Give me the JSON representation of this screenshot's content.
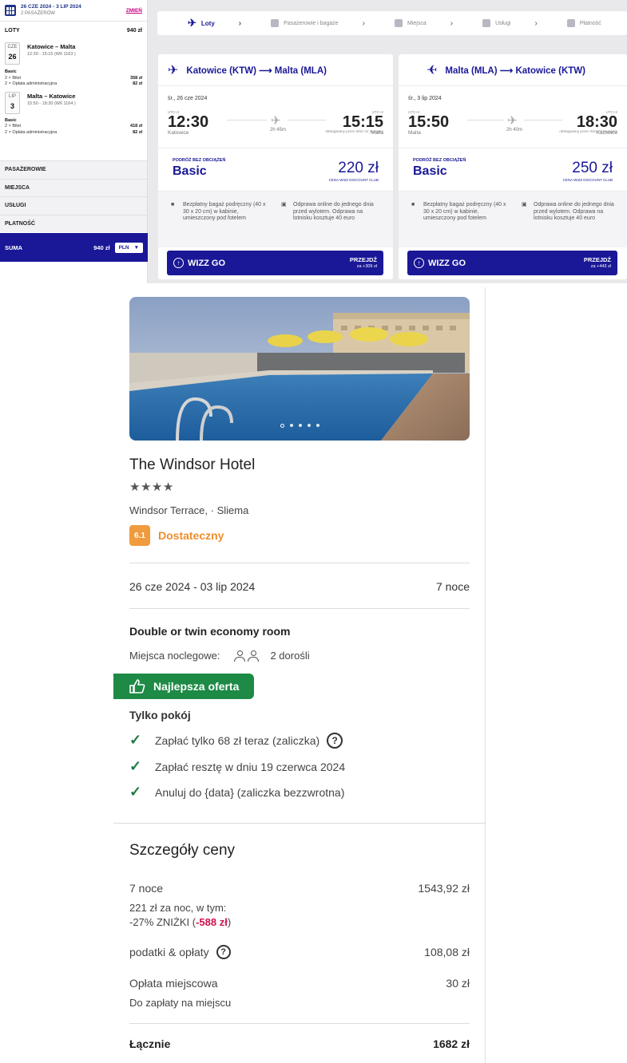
{
  "summary": {
    "dates": "26 CZE 2024 - 3 LIP 2024",
    "passengers": "2 PASAŻERÓW",
    "change": "ZMIEŃ",
    "flights_label": "LOTY",
    "flights_total": "940 zł",
    "legs": [
      {
        "month": "CZE",
        "day": "26",
        "route": "Katowice – Malta",
        "times": "12:30 - 15:15 (W6 1163 )",
        "fare": "Basic",
        "ticket_label": "2 × Bilet",
        "ticket_price": "358 zł",
        "fee_label": "2 × Opłata administracyjna",
        "fee_price": "82 zł"
      },
      {
        "month": "LIP",
        "day": "3",
        "route": "Malta – Katowice",
        "times": "15:50 - 18:30 (W6 1164 )",
        "fare": "Basic",
        "ticket_label": "2 × Bilet",
        "ticket_price": "418 zł",
        "fee_label": "2 × Opłata administracyjna",
        "fee_price": "82 zł"
      }
    ],
    "categories": [
      "PASAŻEROWIE",
      "MIEJSCA",
      "USŁUGI",
      "PŁATNOŚĆ"
    ],
    "total_label": "SUMA",
    "total_value": "940 zł",
    "currency": "PLN"
  },
  "steps": [
    "Loty",
    "Pasażerowie i bagaże",
    "Miejsca",
    "Usługi",
    "Płatność"
  ],
  "cards": [
    {
      "route": "Katowice (KTW) ⟶ Malta (MLA)",
      "date": "śr., 26 cze 2024",
      "operator": "obsługiwany przez Wizz Air Hungary",
      "utc_dep": "UTC+2",
      "utc_arr": "UTC+2",
      "dep_time": "12:30",
      "arr_time": "15:15",
      "dep_city": "Katowice",
      "arr_city": "Malta",
      "duration": "2h 45m",
      "fare_label": "PODRÓŻ BEZ OBCIĄŻEŃ",
      "fare_name": "Basic",
      "price": "220 zł",
      "club": "CENA WIZZ DISCOUNT CLUB",
      "feat1": "Bezpłatny bagaż podręczny (40 x 30 x 20 cm) w kabinie, umieszczony pod fotelem",
      "feat2": "Odprawa online do jednego dnia przed wylotem. Odprawa na lotnisku kosztuje 40 euro",
      "go_label": "WIZZ GO",
      "go_action": "PRZEJDŹ",
      "go_extra": "za +309 zł"
    },
    {
      "route": "Malta (MLA) ⟶ Katowice (KTW)",
      "date": "śr., 3 lip 2024",
      "operator": "obsługiwany przez Wizz Air Hungary",
      "utc_dep": "UTC+2",
      "utc_arr": "UTC+2",
      "dep_time": "15:50",
      "arr_time": "18:30",
      "dep_city": "Malta",
      "arr_city": "Katowice",
      "duration": "2h 40m",
      "fare_label": "PODRÓŻ BEZ OBCIĄŻEŃ",
      "fare_name": "Basic",
      "price": "250 zł",
      "club": "CENA WIZZ DISCOUNT CLUB",
      "feat1": "Bezpłatny bagaż podręczny (40 x 30 x 20 cm) w kabinie, umieszczony pod fotelem",
      "feat2": "Odprawa online do jednego dnia przed wylotem. Odprawa na lotnisku kosztuje 40 euro",
      "go_label": "WIZZ GO",
      "go_action": "PRZEJDŹ",
      "go_extra": "za +443 zł"
    }
  ],
  "hotel": {
    "name": "The Windsor Hotel",
    "stars": "★★★★",
    "location": "Windsor Terrace, · Sliema",
    "rating": "6.1",
    "rating_word": "Dostateczny",
    "dates": "26 cze 2024 - 03 lip 2024",
    "nights": "7 noce",
    "room": "Double or twin economy room",
    "beds_label": "Miejsca noclegowe:",
    "guests": "2 dorośli",
    "best_offer": "Najlepsza oferta",
    "room_only": "Tylko pokój",
    "perks": [
      "Zapłać tylko 68 zł teraz (zaliczka)",
      "Zapłać resztę w dniu 19 czerwca 2024",
      "Anuluj do {data} (zaliczka bezzwrotna)"
    ]
  },
  "price": {
    "title": "Szczegóły ceny",
    "nights_label": "7 noce",
    "nights_value": "1543,92 zł",
    "per_night": "221 zł za noc, w tym:",
    "discount_prefix": "-27% ZNIŻKI (",
    "discount_value": "-588 zł",
    "discount_suffix": ")",
    "taxes_label": "podatki & opłaty",
    "taxes_value": "108,08 zł",
    "local_label": "Opłata miejscowa",
    "local_value": "30 zł",
    "local_note": "Do zapłaty na miejscu",
    "total_label": "Łącznie",
    "total_value": "1682 zł"
  }
}
